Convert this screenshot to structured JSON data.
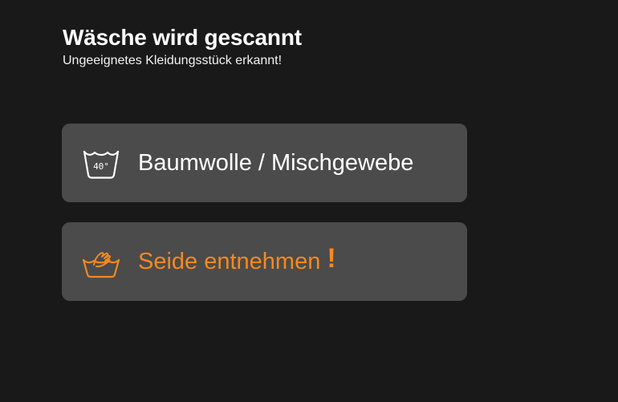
{
  "header": {
    "title": "Wäsche wird gescannt",
    "subtitle": "Ungeeignetes Kleidungsstück erkannt!"
  },
  "items": [
    {
      "label": "Baumwolle / Mischgewebe",
      "icon": "wash-40-degree-icon",
      "icon_text": "40°",
      "color": "#ffffff"
    },
    {
      "label": "Seide entnehmen",
      "icon": "hand-wash-icon",
      "warning": "!",
      "color": "#f5891f"
    }
  ],
  "colors": {
    "background": "#191919",
    "card": "#4b4b4b",
    "accent": "#f5891f"
  }
}
